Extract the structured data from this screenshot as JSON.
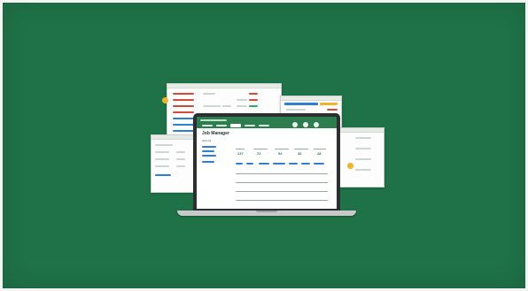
{
  "laptop": {
    "app_title": "Job Manager",
    "filter_label": "Jobs All",
    "stat_values": [
      "137",
      "72",
      "54",
      "36",
      "28"
    ]
  },
  "colors": {
    "background": "#1f7147",
    "app_bar": "#2d7d4f",
    "accent_blue": "#2f7fd1",
    "accent_red": "#d64a3a",
    "accent_yellow": "#f0b429"
  },
  "icons": {
    "badge_left": "yellow-badge-icon",
    "badge_right": "yellow-badge-icon"
  }
}
